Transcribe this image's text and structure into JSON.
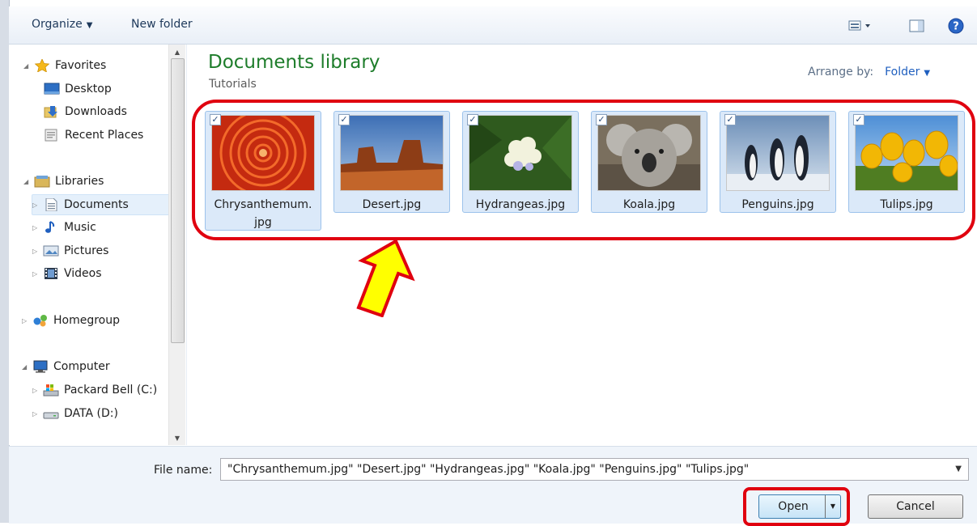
{
  "toolbar": {
    "organize_label": "Organize",
    "new_folder_label": "New folder",
    "icons": [
      "view-icon",
      "preview-pane-icon",
      "help-icon"
    ]
  },
  "nav": {
    "favorites": {
      "label": "Favorites",
      "items": [
        "Desktop",
        "Downloads",
        "Recent Places"
      ]
    },
    "libraries": {
      "label": "Libraries",
      "items": [
        "Documents",
        "Music",
        "Pictures",
        "Videos"
      ],
      "selected": "Documents"
    },
    "homegroup": "Homegroup",
    "computer": {
      "label": "Computer",
      "items": [
        "Packard Bell (C:)",
        "DATA (D:)"
      ]
    }
  },
  "content": {
    "title": "Documents library",
    "subtitle": "Tutorials",
    "arrange_label": "Arrange by:",
    "arrange_value": "Folder"
  },
  "files": [
    {
      "name_line1": "Chrysanthemum.",
      "name_line2": "jpg",
      "checked": true
    },
    {
      "name_line1": "Desert.jpg",
      "checked": true
    },
    {
      "name_line1": "Hydrangeas.jpg",
      "checked": true
    },
    {
      "name_line1": "Koala.jpg",
      "checked": true
    },
    {
      "name_line1": "Penguins.jpg",
      "checked": true
    },
    {
      "name_line1": "Tulips.jpg",
      "checked": true
    }
  ],
  "bottom": {
    "file_name_label": "File name:",
    "file_name_value": "\"Chrysanthemum.jpg\" \"Desert.jpg\" \"Hydrangeas.jpg\" \"Koala.jpg\" \"Penguins.jpg\" \"Tulips.jpg\"",
    "open_label": "Open",
    "cancel_label": "Cancel"
  },
  "colors": {
    "highlight": "#e0000f",
    "arrow": "#ffff00",
    "library_title": "#1e7d2b"
  }
}
